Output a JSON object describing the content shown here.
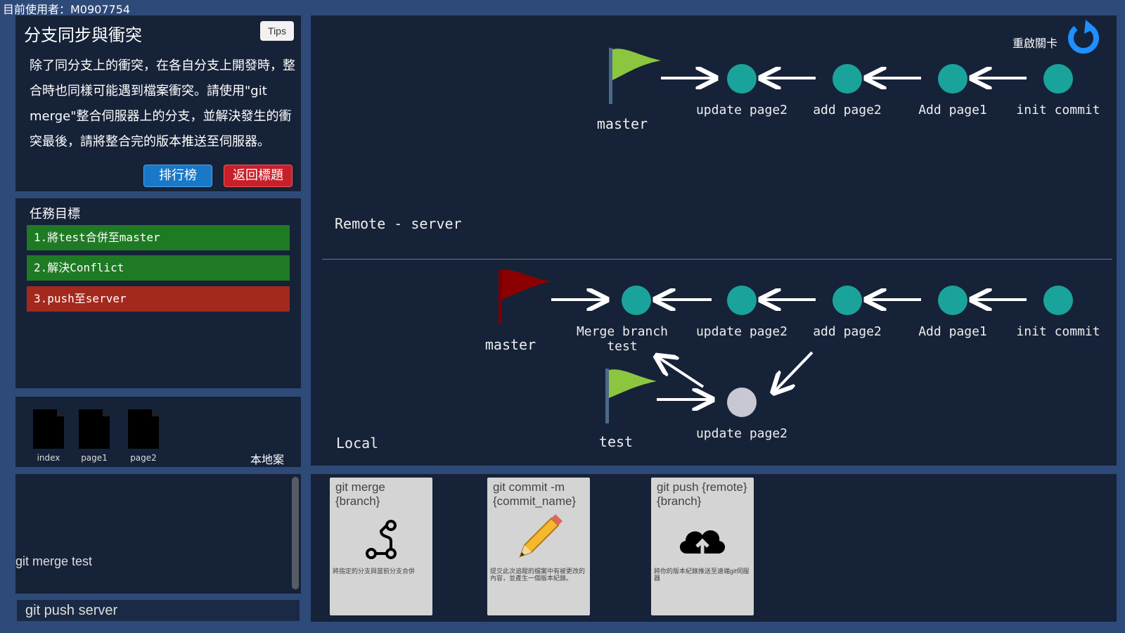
{
  "header": {
    "user_label": "目前使用者：M0907754"
  },
  "level": {
    "title": "分支同步與衝突",
    "tips_label": "Tips",
    "description": "除了同分支上的衝突，在各自分支上開發時，整合時也同樣可能遇到檔案衝突。請使用\"git merge\"整合伺服器上的分支，並解決發生的衝突最後，請將整合完的版本推送至伺服器。",
    "rank_button": "排行榜",
    "back_button": "返回標題"
  },
  "mission": {
    "title": "任務目標",
    "goals": [
      {
        "label": "1.將test合併至master",
        "status": "done"
      },
      {
        "label": "2.解決Conflict",
        "status": "done"
      },
      {
        "label": "3.push至server",
        "status": "todo"
      }
    ]
  },
  "local_files": {
    "label": "本地案",
    "files": [
      "index",
      "page1",
      "page2"
    ]
  },
  "console": {
    "history_line": "git merge test",
    "input_value": "git push server"
  },
  "graph": {
    "restart_label": "重啟關卡",
    "remote": {
      "label": "Remote - server",
      "branch": "master",
      "commits": [
        "update page2",
        "add page2",
        "Add page1",
        "init commit"
      ]
    },
    "local": {
      "label": "Local",
      "master_branch": "master",
      "master_commits": [
        "Merge branch test",
        "update page2",
        "add page2",
        "Add page1",
        "init commit"
      ],
      "test_branch": "test",
      "test_commit": "update page2"
    },
    "colors": {
      "commit": "#1aa39a",
      "test_commit": "#c8c8d4",
      "remote_flag": "#8cc63f",
      "local_master_flag": "#8b0000",
      "test_flag": "#8cc63f",
      "restart_icon": "#1e90ff"
    }
  },
  "cards": [
    {
      "title": "git merge {branch}",
      "description": "將指定的分支與當前分支合併",
      "icon": "merge-icon"
    },
    {
      "title": "git commit -m {commit_name}",
      "description": "提交此次追蹤的檔案中有被更改的內容，並產生一個版本紀錄。",
      "icon": "pencil-icon"
    },
    {
      "title": "git push {remote} {branch}",
      "description": "將你的版本紀錄推送至遠端git伺服器",
      "icon": "cloud-upload-icon"
    }
  ]
}
